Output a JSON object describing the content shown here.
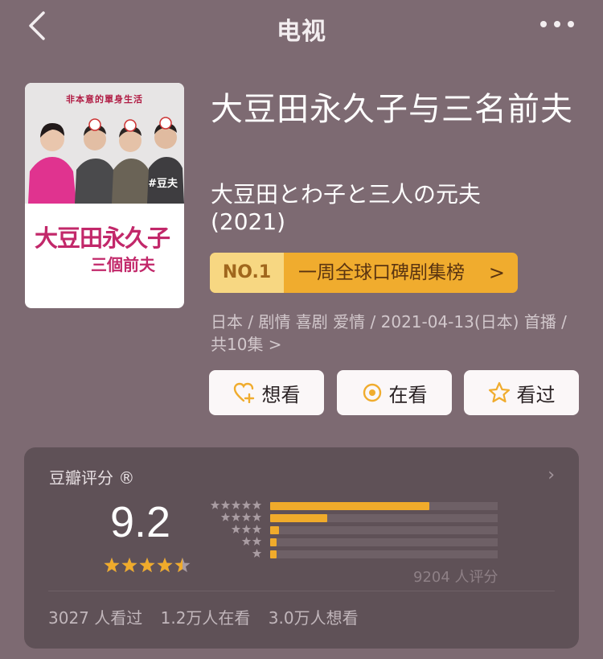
{
  "nav": {
    "title": "电视"
  },
  "poster": {
    "tagline": "非本意的單身生活",
    "hashtag": "#豆夫",
    "logo_line1": "大豆田永久子",
    "logo_line2": "三個前夫"
  },
  "show": {
    "title_zh": "大豆田永久子与三名前夫",
    "title_original": "大豆田とわ子と三人の元夫",
    "year": "(2021)",
    "meta": "日本 / 剧情 喜剧 爱情 / 2021-04-13(日本) 首播 / 共10集 >"
  },
  "ranking": {
    "badge": "NO.1",
    "text": "一周全球口碑剧集榜",
    "arrow": ">"
  },
  "actions": [
    {
      "label": "想看",
      "icon": "heart-plus-icon"
    },
    {
      "label": "在看",
      "icon": "target-icon"
    },
    {
      "label": "看过",
      "icon": "star-outline-icon"
    }
  ],
  "rating": {
    "header": "豆瓣评分 ®",
    "score": "9.2",
    "stars": 4.5,
    "count": "9204 人评分",
    "distribution": [
      {
        "stars": 5,
        "fraction": 0.7
      },
      {
        "stars": 4,
        "fraction": 0.25
      },
      {
        "stars": 3,
        "fraction": 0.04
      },
      {
        "stars": 2,
        "fraction": 0.03
      },
      {
        "stars": 1,
        "fraction": 0.03
      }
    ],
    "stats": [
      "3027 人看过",
      "1.2万人在看",
      "3.0万人想看"
    ]
  },
  "colors": {
    "background": "#7d6a72",
    "accent": "#f0ac2e",
    "card": "#5f5157"
  }
}
